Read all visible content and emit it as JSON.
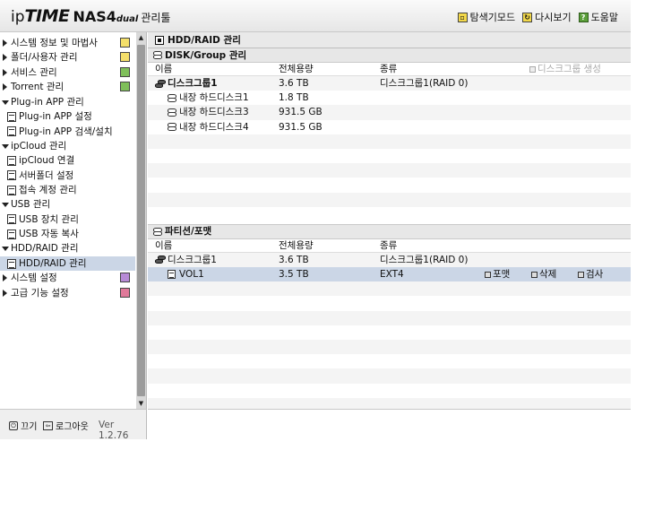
{
  "header": {
    "logo_ip": "ip",
    "logo_time": "TIME",
    "logo_model": "NAS4",
    "logo_dual": "dual",
    "logo_manager": "관리툴",
    "links": [
      {
        "label": "탐색기모드",
        "icon": "explorer-icon"
      },
      {
        "label": "다시보기",
        "icon": "refresh-icon"
      },
      {
        "label": "도움말",
        "icon": "help-icon"
      }
    ]
  },
  "sidebar": {
    "items": [
      {
        "label": "시스템 정보 및 마법사",
        "kind": "top",
        "icon_color": "#f4df6a"
      },
      {
        "label": "폴더/사용자 관리",
        "kind": "top",
        "icon_color": "#f4df6a"
      },
      {
        "label": "서비스 관리",
        "kind": "top",
        "icon_color": "#7fbf5a"
      },
      {
        "label": "Torrent 관리",
        "kind": "top",
        "icon_color": "#7fbf5a"
      },
      {
        "label": "Plug-in APP 관리",
        "kind": "open"
      },
      {
        "label": "Plug-in APP 설정",
        "kind": "child"
      },
      {
        "label": "Plug-in APP 검색/설치",
        "kind": "child"
      },
      {
        "label": "ipCloud 관리",
        "kind": "open"
      },
      {
        "label": "ipCloud 연결",
        "kind": "child"
      },
      {
        "label": "서버폴더 설정",
        "kind": "child"
      },
      {
        "label": "접속 계정 관리",
        "kind": "child"
      },
      {
        "label": "USB 관리",
        "kind": "open"
      },
      {
        "label": "USB 장치 관리",
        "kind": "child"
      },
      {
        "label": "USB 자동 복사",
        "kind": "child"
      },
      {
        "label": "HDD/RAID 관리",
        "kind": "open"
      },
      {
        "label": "HDD/RAID 관리",
        "kind": "child",
        "selected": true
      },
      {
        "label": "시스템 설정",
        "kind": "top",
        "icon_color": "#b78bd6"
      },
      {
        "label": "고급 기능 설정",
        "kind": "top",
        "icon_color": "#e07a9a"
      }
    ]
  },
  "footer": {
    "power_label": "끄기",
    "logout_label": "로그아웃",
    "version": "Ver 1.2.76"
  },
  "main": {
    "title": "HDD/RAID 관리",
    "disk_panel": {
      "title": "DISK/Group 관리",
      "columns": {
        "name": "이름",
        "capacity": "전체용량",
        "type": "종류"
      },
      "create_button": "디스크그룹 생성",
      "rows": [
        {
          "name": "디스크그룹1",
          "capacity": "3.6 TB",
          "type": "디스크그룹1(RAID 0)",
          "level": 0
        },
        {
          "name": "내장 하드디스크1",
          "capacity": "1.8 TB",
          "type": "",
          "level": 1
        },
        {
          "name": "내장 하드디스크3",
          "capacity": "931.5 GB",
          "type": "",
          "level": 1
        },
        {
          "name": "내장 하드디스크4",
          "capacity": "931.5 GB",
          "type": "",
          "level": 1
        }
      ],
      "empty_rows": 6
    },
    "partition_panel": {
      "title": "파티션/포맷",
      "columns": {
        "name": "이름",
        "capacity": "전체용량",
        "type": "종류"
      },
      "rows": [
        {
          "name": "디스크그룹1",
          "capacity": "3.6 TB",
          "type": "디스크그룹1(RAID 0)",
          "level": 0
        },
        {
          "name": "VOL1",
          "capacity": "3.5 TB",
          "type": "EXT4",
          "level": 1,
          "selected": true,
          "actions": [
            "포맷",
            "삭제",
            "검사"
          ]
        }
      ],
      "empty_rows": 9
    }
  }
}
